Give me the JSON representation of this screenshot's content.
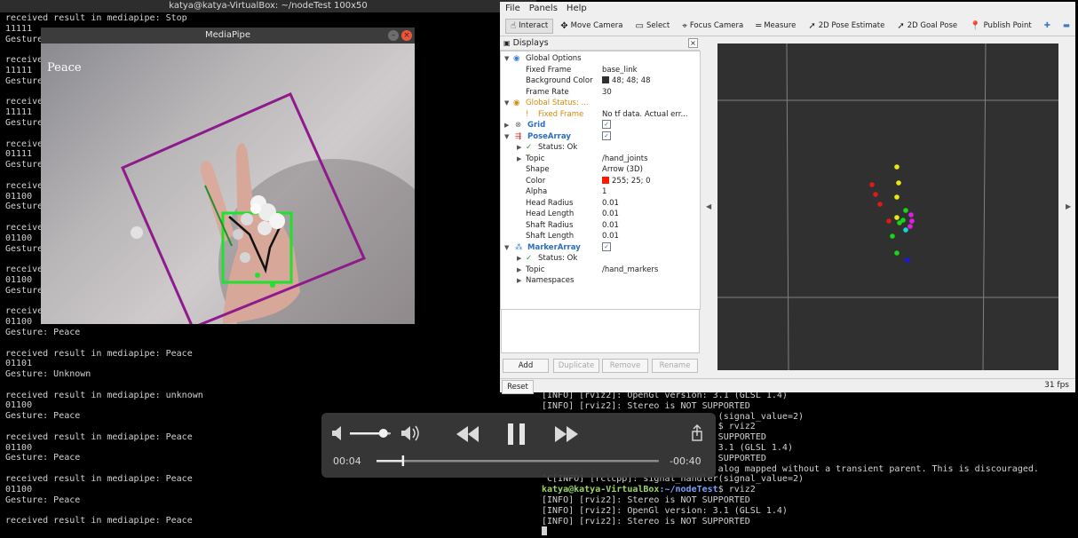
{
  "terminal_left": {
    "title": "katya@katya-VirtualBox: ~/nodeTest 100x50",
    "lines": [
      "received result in mediapipe: Stop",
      "11111",
      "Gesture: Stop",
      "",
      "received result in mediapipe: Stop",
      "11111",
      "Gesture: Stop",
      "",
      "received result in mediapipe: Stop",
      "11111",
      "Gesture: Stop",
      "",
      "received result in mediapipe: Stop",
      "01111",
      "Gesture: Stop",
      "",
      "received result in mediapipe: Peace",
      "01100",
      "Gesture: Peace",
      "",
      "received result in mediapipe: Peace",
      "01100",
      "Gesture: Peace",
      "",
      "received result in mediapipe: Peace",
      "01100",
      "Gesture: Peace",
      "",
      "received result in mediapipe: Peace",
      "01100",
      "Gesture: Peace",
      "",
      "received result in mediapipe: Peace",
      "01101",
      "Gesture: Unknown",
      "",
      "received result in mediapipe: unknown",
      "01100",
      "Gesture: Peace",
      "",
      "received result in mediapipe: Peace",
      "01100",
      "Gesture: Peace",
      "",
      "received result in mediapipe: Peace",
      "01100",
      "Gesture: Peace",
      "",
      "received result in mediapipe: Peace"
    ]
  },
  "mediapipe": {
    "title": "MediaPipe",
    "gesture_label": "Peace"
  },
  "rviz": {
    "menu": [
      "File",
      "Panels",
      "Help"
    ],
    "tools": [
      {
        "label": "Interact",
        "icon": "interact-icon",
        "glyph": "☝"
      },
      {
        "label": "Move Camera",
        "icon": "move-camera-icon",
        "glyph": "✥"
      },
      {
        "label": "Select",
        "icon": "select-icon",
        "glyph": "▭"
      },
      {
        "label": "Focus Camera",
        "icon": "focus-camera-icon",
        "glyph": "⌖"
      },
      {
        "label": "Measure",
        "icon": "measure-icon",
        "glyph": "═"
      },
      {
        "label": "2D Pose Estimate",
        "icon": "pose-estimate-icon",
        "glyph": "➚"
      },
      {
        "label": "2D Goal Pose",
        "icon": "goal-pose-icon",
        "glyph": "➚"
      },
      {
        "label": "Publish Point",
        "icon": "publish-point-icon",
        "glyph": "📍"
      }
    ],
    "displays_title": "Displays",
    "tree": {
      "global_options": "Global Options",
      "fixed_frame_key": "Fixed Frame",
      "fixed_frame_val": "base_link",
      "bg_color_key": "Background Color",
      "bg_color_val": "48; 48; 48",
      "bg_color_hex": "#303030",
      "frame_rate_key": "Frame Rate",
      "frame_rate_val": "30",
      "global_status": "Global Status: ...",
      "fixed_frame_warn_key": "Fixed Frame",
      "fixed_frame_warn_val": "No tf data.  Actual err...",
      "grid": "Grid",
      "pose_array": "PoseArray",
      "status_ok": "Status: Ok",
      "topic_key": "Topic",
      "pose_topic": "/hand_joints",
      "shape_key": "Shape",
      "shape_val": "Arrow (3D)",
      "color_key": "Color",
      "color_val": "255; 25; 0",
      "color_hex": "#ff1900",
      "alpha_key": "Alpha",
      "alpha_val": "1",
      "head_radius_key": "Head Radius",
      "head_radius_val": "0.01",
      "head_length_key": "Head Length",
      "head_length_val": "0.01",
      "shaft_radius_key": "Shaft Radius",
      "shaft_radius_val": "0.01",
      "shaft_length_key": "Shaft Length",
      "shaft_length_val": "0.01",
      "marker_array": "MarkerArray",
      "marker_status": "Status: Ok",
      "marker_topic_key": "Topic",
      "marker_topic": "/hand_markers",
      "namespaces": "Namespaces"
    },
    "buttons": {
      "add": "Add",
      "duplicate": "Duplicate",
      "remove": "Remove",
      "rename": "Rename",
      "reset": "Reset"
    },
    "fps": "31 fps"
  },
  "terminal_right": {
    "lines": [
      "[INFO] [rviz2]: OpenGl version: 3.1 (GLSL 1.4)",
      "[INFO] [rviz2]: Stereo is NOT SUPPORTED",
      "                                 (signal_value=2)",
      "                                 $ rviz2",
      "                                 SUPPORTED",
      "                                 3.1 (GLSL 1.4)",
      "                                 SUPPORTED",
      "                                 alog mapped without a transient parent. This is discouraged.",
      "^C[INFO] [rclcpp]: signal_handler(signal_value=2)"
    ],
    "prompt_user": "katya@katya-VirtualBox",
    "prompt_path": ":~/nodeTest",
    "prompt_cmd": "$ rviz2",
    "after": [
      "[INFO] [rviz2]: Stereo is NOT SUPPORTED",
      "[INFO] [rviz2]: OpenGl version: 3.1 (GLSL 1.4)",
      "[INFO] [rviz2]: Stereo is NOT SUPPORTED"
    ]
  },
  "player": {
    "elapsed": "00:04",
    "remaining": "-00:40",
    "progress": 0.09,
    "volume": 0.82
  }
}
